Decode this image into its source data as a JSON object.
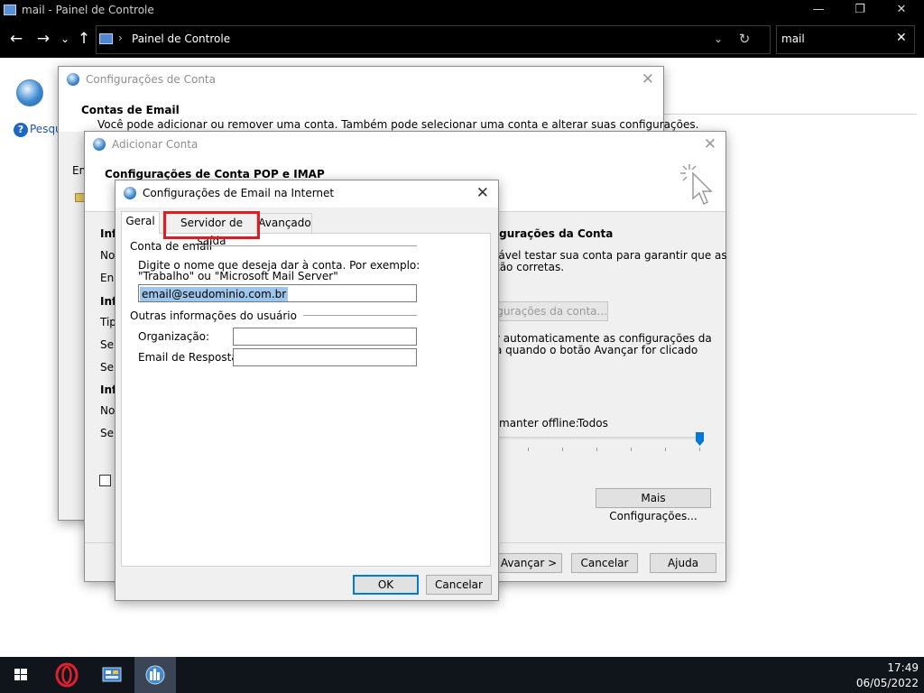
{
  "window": {
    "title": "mail - Painel de Controle",
    "minimize_glyph": "—",
    "restore_glyph": "❐",
    "close_glyph": "✕"
  },
  "address": {
    "path": "Painel de Controle",
    "separator": "›",
    "dropdown_glyph": "⌄",
    "refresh_glyph": "↻",
    "search_value": "mail",
    "search_clear_glyph": "✕"
  },
  "nav": {
    "back_glyph": "←",
    "forward_glyph": "→",
    "recent_glyph": "⌄",
    "up_glyph": "↑"
  },
  "page": {
    "help_icon": "?",
    "search_link": "Pesqu"
  },
  "account_settings": {
    "title": "Configurações de Conta",
    "heading": "Contas de Email",
    "description": "Você pode adicionar ou remover uma conta. Também pode selecionar uma conta e alterar suas configurações.",
    "tab_partial": "Em",
    "close_glyph": "✕"
  },
  "add_account": {
    "title": "Adicionar Conta",
    "heading": "Configurações de Conta POP e IMAP",
    "close_glyph": "✕",
    "left_labels": [
      "Info",
      "Nor",
      "End",
      "Info",
      "Tip",
      "Ser",
      "Ser",
      "Info",
      "Nor",
      "Ser"
    ],
    "left_list_partial": "N",
    "test_heading": "igurações da Conta",
    "test_text_1": "lável testar sua conta para garantir que as",
    "test_text_2": "tão corretas.",
    "test_button": "nfigurações da conta...",
    "auto_text_1": "r automaticamente as configurações da",
    "auto_text_2": "a quando o botão Avançar for clicado",
    "offline_label": "manter offline:",
    "offline_value": "Todos",
    "offline_fraction": 1.0,
    "more_settings_button": "Mais Configurações...",
    "next_button": "Avançar >",
    "cancel_button": "Cancelar",
    "help_button": "Ajuda"
  },
  "internet_email": {
    "title": "Configurações de Email na Internet",
    "close_glyph": "✕",
    "tabs": [
      "Geral",
      "Servidor de saída",
      "Avançado"
    ],
    "group_account": "Conta de email",
    "instruction_1": "Digite o nome que deseja dar à conta. Por exemplo:",
    "instruction_2": "\"Trabalho\" ou \"Microsoft Mail Server\"",
    "account_name_value": "email@seudominio.com.br",
    "group_user": "Outras informações do usuário",
    "org_label": "Organização:",
    "org_value": "",
    "reply_label": "Email de Resposta:",
    "reply_value": "",
    "ok_button": "OK",
    "cancel_button": "Cancelar"
  },
  "taskbar": {
    "time": "17:49",
    "date": "06/05/2022"
  }
}
